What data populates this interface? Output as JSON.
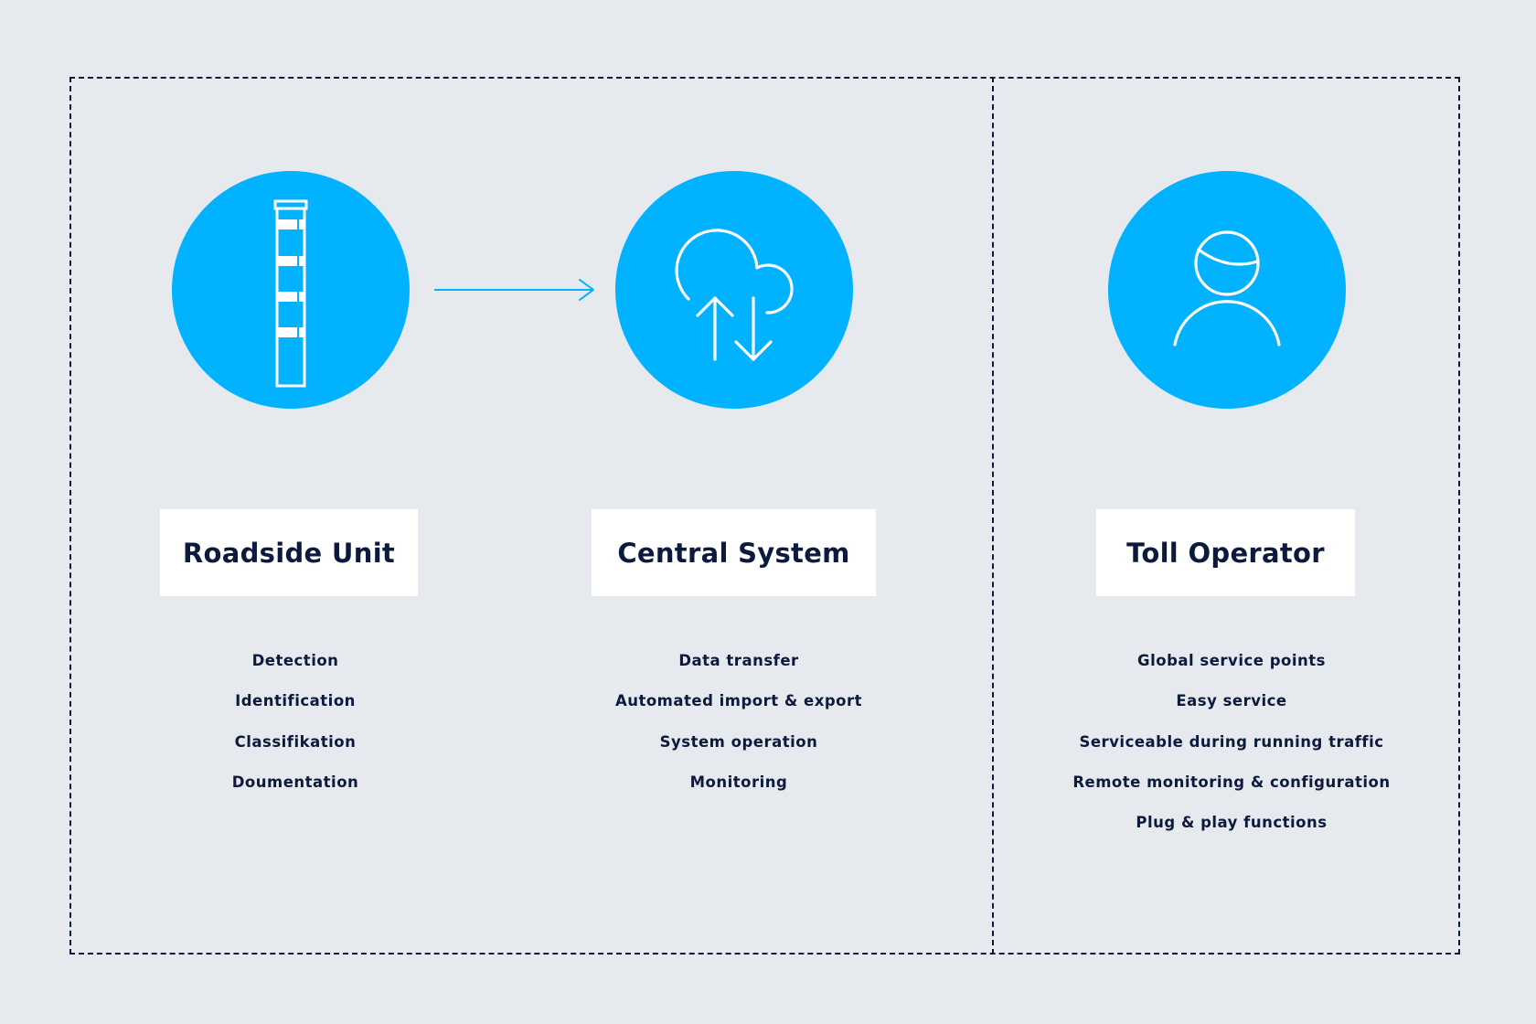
{
  "colors": {
    "background": "#e6eaee",
    "accent": "#00b2ff",
    "text": "#0c1a3d",
    "box": "#ffffff",
    "border": "#0c1a3d"
  },
  "flow": {
    "arrow_from": "Roadside Unit",
    "arrow_to": "Central System",
    "arrow_icon": "arrow-right-icon"
  },
  "columns": [
    {
      "icon": "road-post-icon",
      "title": "Roadside Unit",
      "items": [
        "Detection",
        "Identification",
        "Classifikation",
        "Doumentation"
      ]
    },
    {
      "icon": "cloud-sync-icon",
      "title": "Central System",
      "items": [
        "Data transfer",
        "Automated import & export",
        "System operation",
        "Monitoring"
      ]
    },
    {
      "icon": "user-icon",
      "title": "Toll Operator",
      "items": [
        "Global service points",
        "Easy service",
        "Serviceable during running traffic",
        "Remote monitoring & configuration",
        "Plug & play functions"
      ]
    }
  ]
}
